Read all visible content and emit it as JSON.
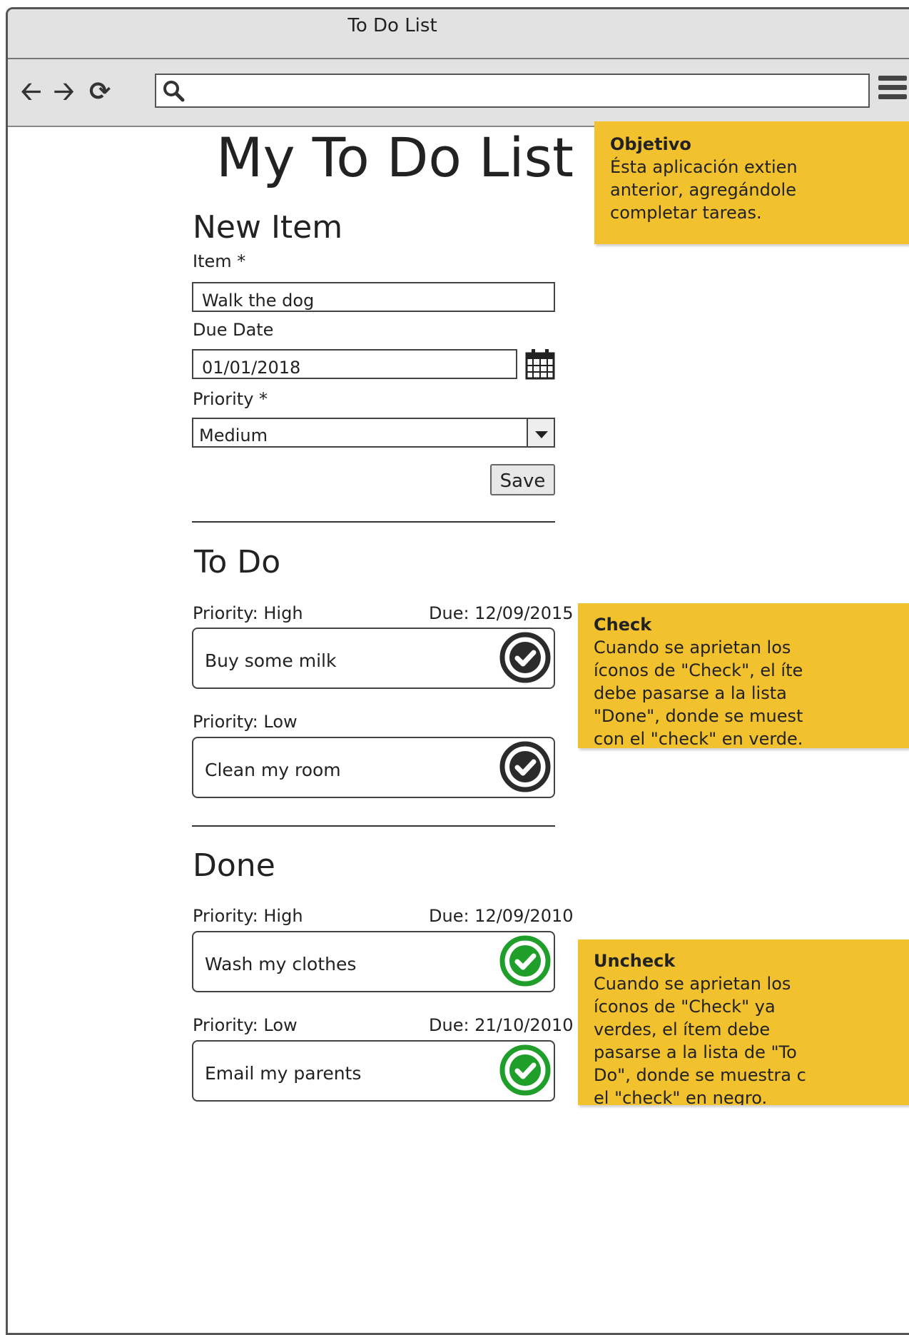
{
  "window": {
    "title": "To Do List"
  },
  "browser": {
    "address_value": ""
  },
  "page": {
    "title": "My To Do List",
    "new_item": {
      "heading": "New Item",
      "item_label": "Item *",
      "item_value": "Walk the dog",
      "due_label": "Due Date",
      "due_value": "01/01/2018",
      "priority_label": "Priority *",
      "priority_value": "Medium",
      "save_label": "Save"
    },
    "todo": {
      "heading": "To Do",
      "items": [
        {
          "priority": "Priority: High",
          "due": "Due: 12/09/2015",
          "text": "Buy some milk",
          "status": "check-black"
        },
        {
          "priority": "Priority: Low",
          "due": "",
          "text": "Clean my room",
          "status": "check-black"
        }
      ]
    },
    "done": {
      "heading": "Done",
      "items": [
        {
          "priority": "Priority: High",
          "due": "Due: 12/09/2010",
          "text": "Wash my clothes",
          "status": "check-green"
        },
        {
          "priority": "Priority: Low",
          "due": "Due: 21/10/2010",
          "text": "Email my parents",
          "status": "check-green"
        }
      ]
    }
  },
  "notes": [
    {
      "title": "Objetivo",
      "body": "Ésta aplicación extien\nanterior, agregándole\ncompletar tareas."
    },
    {
      "title": "Check",
      "body": "Cuando se aprietan los\níconos de \"Check\", el íte\ndebe pasarse a la lista\n\"Done\", donde se muest\ncon el \"check\" en verde."
    },
    {
      "title": "Uncheck",
      "body": "Cuando se aprietan los\níconos de \"Check\" ya\nverdes, el ítem debe\npasarse a la lista de \"To\nDo\", donde se muestra c\nel \"check\" en negro."
    }
  ],
  "colors": {
    "note": "#f2c12e",
    "check_black": "#2b2b2b",
    "check_green": "#1f9e2a"
  }
}
